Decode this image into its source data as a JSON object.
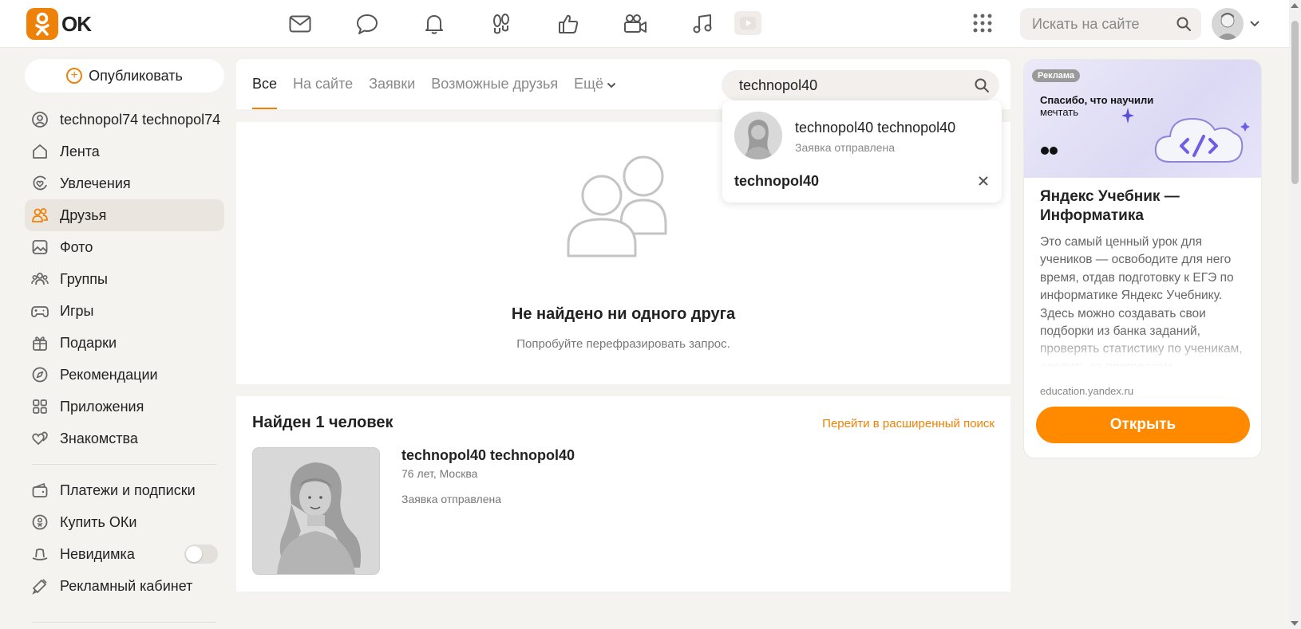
{
  "header": {
    "logo_text": "OK",
    "search_placeholder": "Искать на сайте",
    "icons": [
      "mail-icon",
      "chat-icon",
      "bell-icon",
      "footprints-icon",
      "like-icon",
      "video-camera-icon",
      "music-icon",
      "video-play-icon",
      "apps-grid-icon"
    ]
  },
  "sidebar": {
    "publish_label": "Опубликовать",
    "items": [
      {
        "label": "technopol74 technopol74",
        "icon": "profile-icon"
      },
      {
        "label": "Лента",
        "icon": "home-icon"
      },
      {
        "label": "Увлечения",
        "icon": "heart-circle-icon"
      },
      {
        "label": "Друзья",
        "icon": "friends-icon",
        "active": true
      },
      {
        "label": "Фото",
        "icon": "photo-icon"
      },
      {
        "label": "Группы",
        "icon": "groups-icon"
      },
      {
        "label": "Игры",
        "icon": "gamepad-icon"
      },
      {
        "label": "Подарки",
        "icon": "gift-icon"
      },
      {
        "label": "Рекомендации",
        "icon": "compass-icon"
      },
      {
        "label": "Приложения",
        "icon": "apps-icon"
      },
      {
        "label": "Знакомства",
        "icon": "hearts-icon"
      }
    ],
    "items2": [
      {
        "label": "Платежи и подписки",
        "icon": "wallet-icon"
      },
      {
        "label": "Купить ОКи",
        "icon": "coin-icon"
      },
      {
        "label": "Невидимка",
        "icon": "hat-icon",
        "toggle": false
      },
      {
        "label": "Рекламный кабинет",
        "icon": "megaphone-icon"
      }
    ]
  },
  "tabs": [
    {
      "label": "Все",
      "active": true
    },
    {
      "label": "На сайте"
    },
    {
      "label": "Заявки"
    },
    {
      "label": "Возможные друзья"
    },
    {
      "label": "Ещё"
    }
  ],
  "friend_search": {
    "value": "technopol40"
  },
  "dropdown": {
    "name": "technopol40 technopol40",
    "status": "Заявка отправлена",
    "recent_query": "technopol40"
  },
  "empty_state": {
    "title": "Не найдено ни одного друга",
    "subtitle": "Попробуйте перефразировать запрос."
  },
  "results": {
    "title": "Найден 1 человек",
    "advanced_link": "Перейти в расширенный поиск",
    "person": {
      "name": "technopol40 technopol40",
      "meta": "76 лет, Москва",
      "status": "Заявка отправлена"
    }
  },
  "ad": {
    "label": "Реклама",
    "banner_line1": "Спасибо, что научили",
    "banner_line2": "мечтать",
    "title": "Яндекс Учебник — Информатика",
    "body": "Это самый ценный урок для учеников — освободите для него время, отдав подготовку к ЕГЭ по информатике Яндекс Учебнику. Здесь можно создавать свои подборки из банка заданий, проверять статистику по ученикам, следить за прогрессом",
    "domain": "education.yandex.ru",
    "button": "Открыть"
  },
  "colors": {
    "accent": "#ee8208",
    "background": "#f5f3f0"
  }
}
